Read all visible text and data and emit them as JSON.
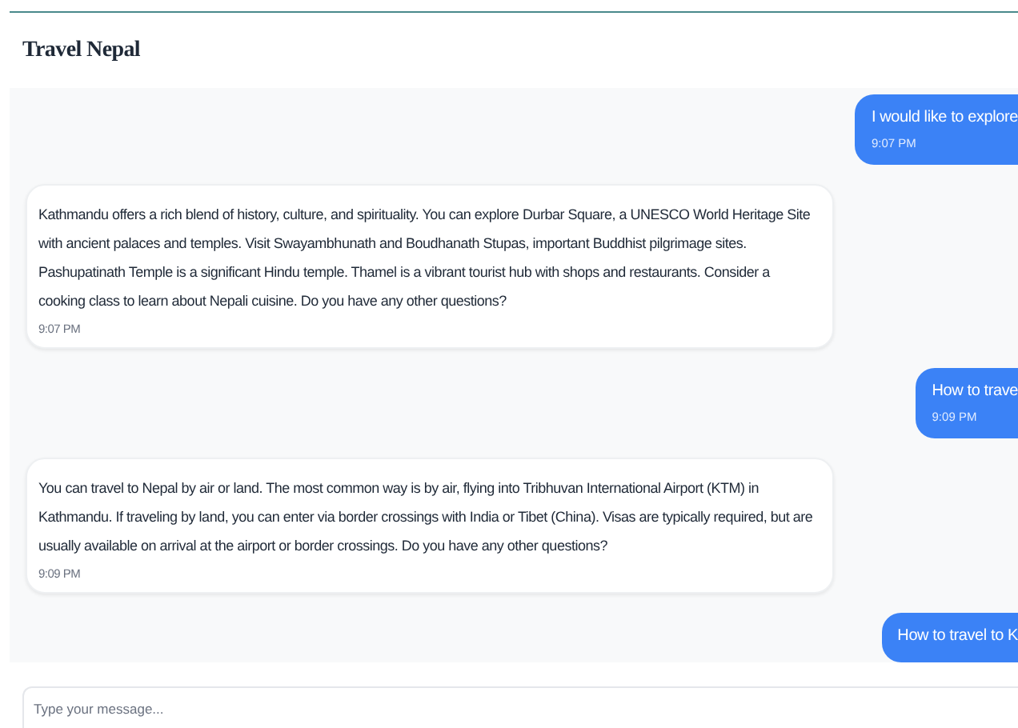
{
  "header": {
    "title": "Travel Nepal"
  },
  "messages": [
    {
      "kind": "user",
      "text": "I would like to explore",
      "time": "9:07 PM"
    },
    {
      "kind": "assistant",
      "text": "Kathmandu offers a rich blend of history, culture, and spirituality. You can explore Durbar Square, a UNESCO World Heritage Site with ancient palaces and temples. Visit Swayambhunath and Boudhanath Stupas, important Buddhist pilgrimage sites. Pashupatinath Temple is a significant Hindu temple. Thamel is a vibrant tourist hub with shops and restaurants. Consider a cooking class to learn about Nepali cuisine. Do you have any other questions?",
      "time": "9:07 PM"
    },
    {
      "kind": "user",
      "text": "How to trave",
      "time": "9:09 PM"
    },
    {
      "kind": "assistant",
      "text": "You can travel to Nepal by air or land. The most common way is by air, flying into Tribhuvan International Airport (KTM) in Kathmandu. If traveling by land, you can enter via border crossings with India or Tibet (China). Visas are typically required, but are usually available on arrival at the airport or border crossings. Do you have any other questions?",
      "time": "9:09 PM"
    },
    {
      "kind": "user",
      "text": "How to travel to K"
    }
  ],
  "composer": {
    "placeholder": "Type your message..."
  }
}
